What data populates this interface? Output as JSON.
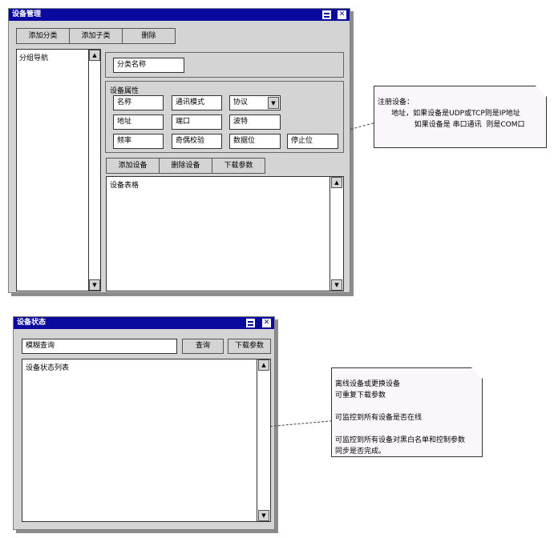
{
  "device_mgmt": {
    "title": "设备管理",
    "toolbar": {
      "add_category": "添加分类",
      "add_sub": "添加子类",
      "delete": "删除"
    },
    "nav_label": "分组导航",
    "category_name": "分类名称",
    "props_title": "设备属性",
    "fields": {
      "name": "名称",
      "comm_mode": "通讯模式",
      "protocol": "协议",
      "address": "地址",
      "port": "端口",
      "baud": "波特",
      "frequency": "频率",
      "parity": "奇偶校验",
      "data_bits": "数据位",
      "stop_bits": "停止位"
    },
    "device_buttons": {
      "add": "添加设备",
      "delete": "删除设备",
      "send": "下载参数"
    },
    "table_label": "设备表格"
  },
  "device_status": {
    "title": "设备状态",
    "search_value": "模糊查询",
    "query_button": "查询",
    "send_button": "下载参数",
    "list_label": "设备状态列表"
  },
  "notes": {
    "register": "注册设备：\n      地址，如果设备是UDP或TCP则是IP地址\n                如果设备是 串口通讯  则是COM口",
    "status": "离线设备或更换设备\n可重复下载参数\n\n可监控到所有设备是否在线\n\n可监控到所有设备对黑白名单和控制参数\n同步是否完成。"
  },
  "icons": [
    "restore-icon",
    "close-icon",
    "scroll-up-icon",
    "scroll-down-icon",
    "dropdown-arrow-icon"
  ],
  "colors": {
    "titlebar": "#0a0a9e",
    "window_bg": "#d4d4d4",
    "note_bg": "#fbf6fb"
  }
}
